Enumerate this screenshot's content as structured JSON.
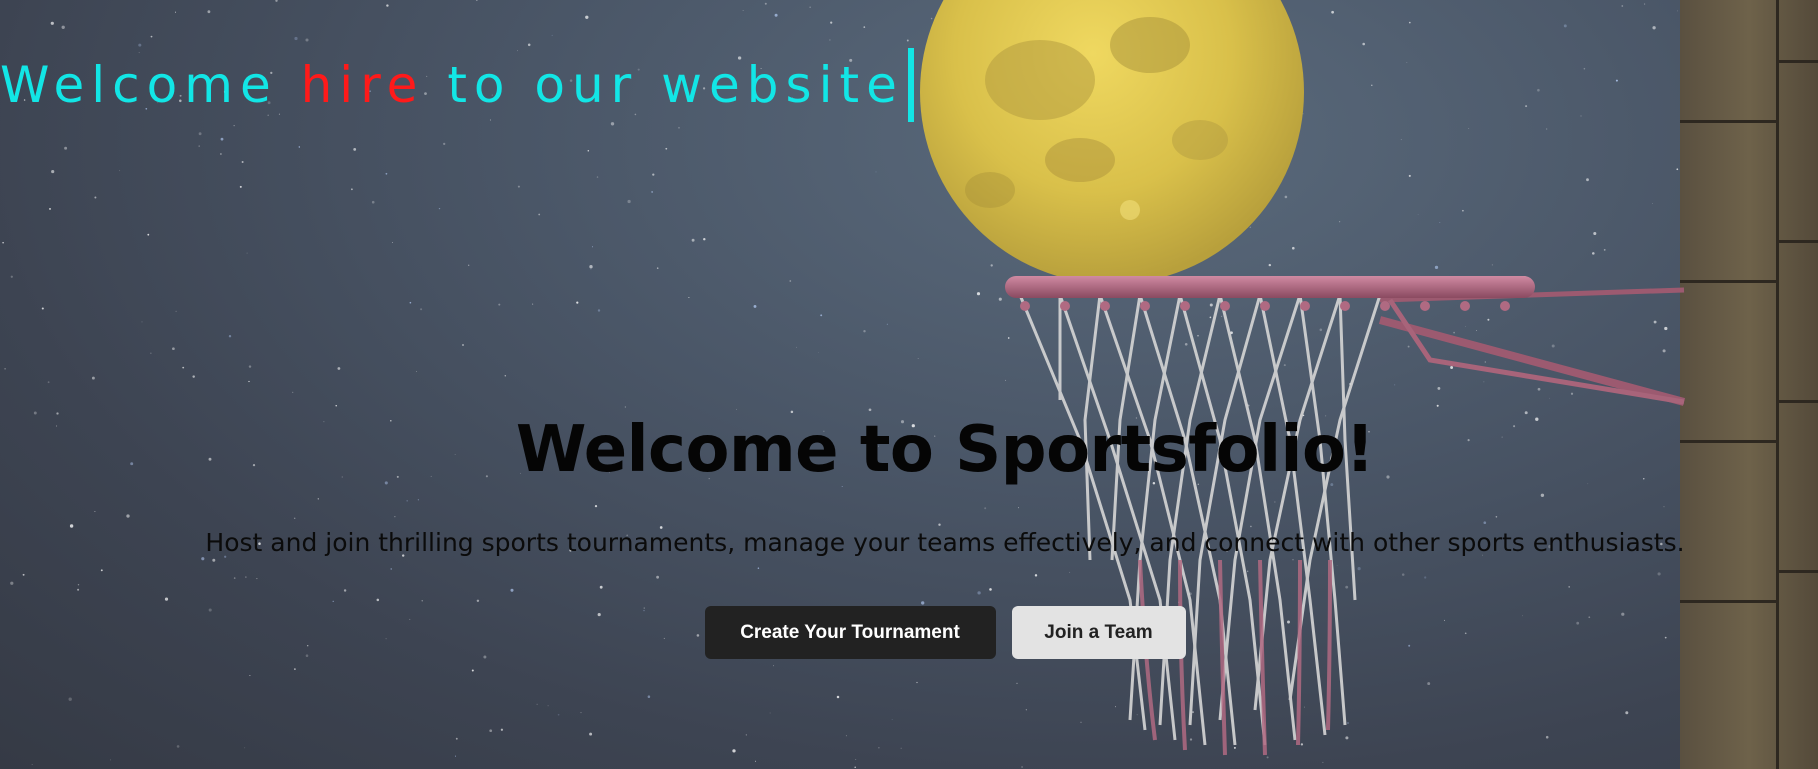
{
  "hero": {
    "typing": {
      "prefix": "Welcome ",
      "highlight": "hire",
      "suffix": " to our website",
      "text_color": "#12e6e6",
      "highlight_color": "#ff1a1a"
    },
    "title": "Welcome to Sportsfolio!",
    "subtitle": "Host and join thrilling sports tournaments, manage your teams effectively, and connect with other sports enthusiasts.",
    "buttons": {
      "create": "Create Your Tournament",
      "join": "Join a Team"
    },
    "background": {
      "image": "night-sky-basketball-hoop-moon",
      "icons": [
        "moon-icon",
        "basketball-hoop-icon",
        "brick-wall-icon"
      ]
    }
  }
}
